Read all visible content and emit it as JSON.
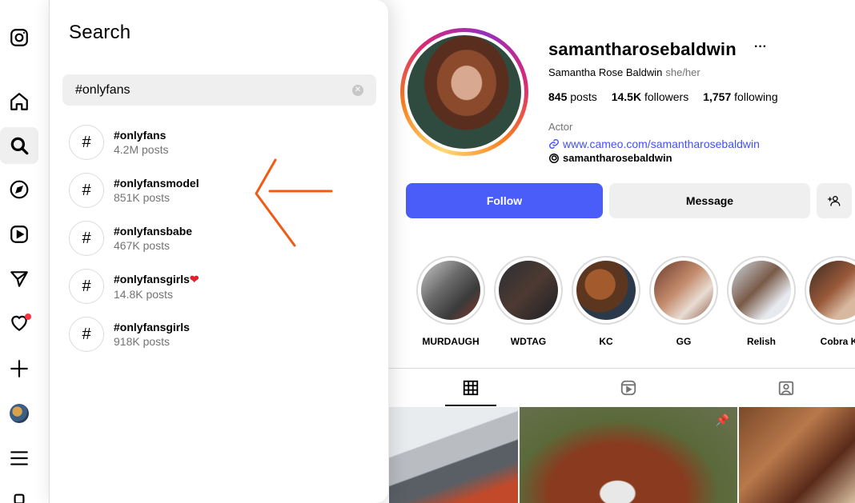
{
  "rail": {
    "items": [
      {
        "icon": "instagram-logo-icon"
      },
      {
        "icon": "home-icon"
      },
      {
        "icon": "search-icon"
      },
      {
        "icon": "explore-compass-icon"
      },
      {
        "icon": "reels-icon"
      },
      {
        "icon": "messages-send-icon"
      },
      {
        "icon": "notifications-heart-icon"
      },
      {
        "icon": "create-plus-icon"
      },
      {
        "icon": "profile-avatar"
      },
      {
        "icon": "more-menu-icon"
      }
    ],
    "notification_dot_color": "#ff3040"
  },
  "search": {
    "title": "Search",
    "query": "#onlyfans",
    "clear_glyph": "✕",
    "results": [
      {
        "glyph": "#",
        "tag": "#onlyfans",
        "count": "4.2M posts"
      },
      {
        "glyph": "#",
        "tag": "#onlyfansmodel",
        "count": "851K posts"
      },
      {
        "glyph": "#",
        "tag": "#onlyfansbabe",
        "count": "467K posts"
      },
      {
        "glyph": "#",
        "tag": "#onlyfansgirls",
        "emoji": "❤",
        "count": "14.8K posts"
      },
      {
        "glyph": "#",
        "tag": "#onlyfansgirls",
        "count": "918K posts"
      }
    ]
  },
  "profile": {
    "username": "samantharosebaldwin",
    "more": "···",
    "full_name": "Samantha Rose Baldwin",
    "pronouns": "she/her",
    "stats": {
      "posts_count": "845",
      "posts_label": "posts",
      "followers_count": "14.5K",
      "followers_label": "followers",
      "following_count": "1,757",
      "following_label": "following"
    },
    "category": "Actor",
    "link_text": "www.cameo.com/samantharosebaldwin",
    "threads_handle": "samantharosebaldwin",
    "buttons": {
      "follow": "Follow",
      "message": "Message"
    },
    "highlights": [
      {
        "label": "MURDAUGH"
      },
      {
        "label": "WDTAG"
      },
      {
        "label": "KC"
      },
      {
        "label": "GG"
      },
      {
        "label": "Relish"
      },
      {
        "label": "Cobra K"
      }
    ],
    "tabs": [
      {
        "icon": "posts-grid-icon"
      },
      {
        "icon": "reels-tab-icon"
      },
      {
        "icon": "tagged-icon"
      }
    ]
  },
  "colors": {
    "accent_blue": "#4a5df9",
    "link_blue": "#4150f7",
    "annotation_orange": "#f05a14"
  }
}
